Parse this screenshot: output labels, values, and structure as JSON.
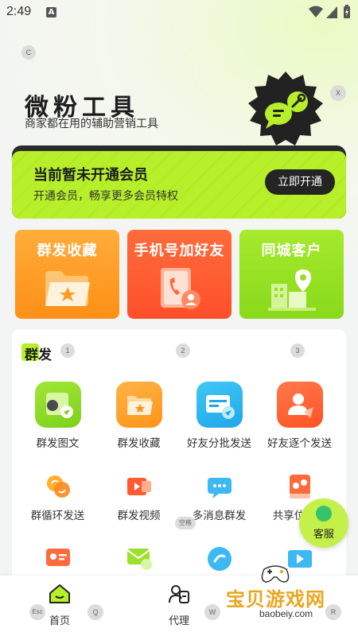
{
  "status_bar": {
    "time": "2:49",
    "notification_icon": "A"
  },
  "key_hints": {
    "c": "C",
    "x": "X",
    "n1": "1",
    "n2": "2",
    "n3": "3",
    "space": "空格",
    "esc": "Esc",
    "q": "Q",
    "w": "W",
    "r": "R"
  },
  "hero": {
    "title": "微粉工具",
    "subtitle": "商家都在用的辅助营销工具",
    "icon": "chat-wrench-badge-icon"
  },
  "member": {
    "title": "当前暂未开通会员",
    "desc": "开通会员，畅享更多会员特权",
    "button": "立即开通"
  },
  "feature_cards": [
    {
      "label": "群发收藏",
      "icon": "folder-star-icon",
      "color": "#ff9a22"
    },
    {
      "label": "手机号加好友",
      "icon": "contacts-book-icon",
      "color": "#ff5a30"
    },
    {
      "label": "同城客户",
      "icon": "city-location-icon",
      "color": "#97df23"
    }
  ],
  "group": {
    "title": "群发",
    "tools": [
      {
        "label": "群发图文",
        "icon": "image-send-icon"
      },
      {
        "label": "群发收藏",
        "icon": "folder-star-icon"
      },
      {
        "label": "好友分批发送",
        "icon": "batch-send-icon"
      },
      {
        "label": "好友逐个发送",
        "icon": "person-send-icon"
      },
      {
        "label": "群循环发送",
        "icon": "loop-send-icon"
      },
      {
        "label": "群发视频",
        "icon": "video-icon"
      },
      {
        "label": "多消息群发",
        "icon": "multi-message-icon"
      },
      {
        "label": "共享位置群",
        "icon": "location-share-icon"
      },
      {
        "label": "",
        "icon": "card-send-icon"
      },
      {
        "label": "",
        "icon": "mail-check-icon"
      },
      {
        "label": "",
        "icon": "link-icon"
      },
      {
        "label": "",
        "icon": "media-icon"
      }
    ]
  },
  "customer_service": {
    "label": "客服"
  },
  "bottom_nav": [
    {
      "label": "首页",
      "icon": "home-icon",
      "active": true
    },
    {
      "label": "代理",
      "icon": "agent-icon",
      "active": false
    }
  ],
  "watermark": {
    "text": "宝贝游戏网",
    "url": "baobeiy.com"
  },
  "colors": {
    "accent": "#b7ef2a",
    "dark": "#242424"
  }
}
